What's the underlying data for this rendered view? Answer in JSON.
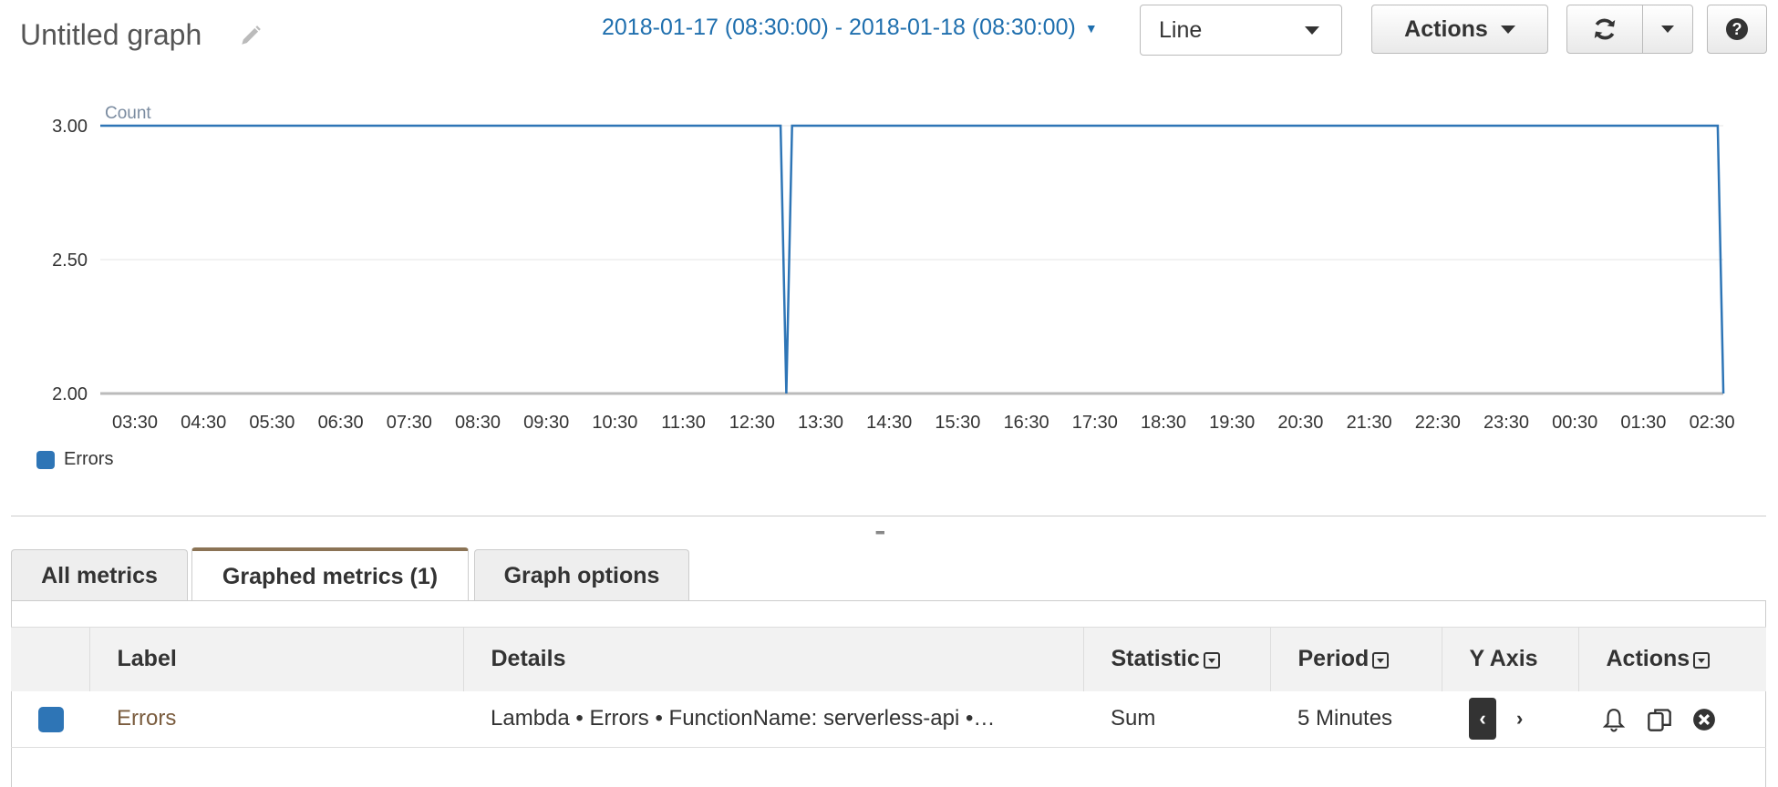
{
  "header": {
    "title": "Untitled graph",
    "date_range": "2018-01-17 (08:30:00) - 2018-01-18 (08:30:00)",
    "chart_type_select": "Line",
    "actions_label": "Actions",
    "help_label": "?"
  },
  "icons": {
    "edit": "pencil-icon",
    "date_caret": "caret-down-icon",
    "refresh": "refresh-icon",
    "refresh_dropdown": "caret-down-icon",
    "help": "question-circle-icon",
    "alarm": "bell-icon",
    "duplicate": "copy-icon",
    "remove": "close-circle-icon"
  },
  "colors": {
    "series": "#2e75b6",
    "link": "#1f6fae",
    "active_tab_accent": "#8b7355"
  },
  "chart_data": {
    "type": "line",
    "ylabel": "Count",
    "ylim": [
      2.0,
      3.0
    ],
    "y_ticks": [
      "3.00",
      "2.50",
      "2.00"
    ],
    "x_ticks": [
      "03:30",
      "04:30",
      "05:30",
      "06:30",
      "07:30",
      "08:30",
      "09:30",
      "10:30",
      "11:30",
      "12:30",
      "13:30",
      "14:30",
      "15:30",
      "16:30",
      "17:30",
      "18:30",
      "19:30",
      "20:30",
      "21:30",
      "22:30",
      "23:30",
      "00:30",
      "01:30",
      "02:30"
    ],
    "grid": true,
    "legend_placement": "bottom-left",
    "series": [
      {
        "name": "Errors",
        "points": [
          {
            "x": "03:10",
            "y": 3
          },
          {
            "x": "12:55",
            "y": 3
          },
          {
            "x": "13:00",
            "y": 2
          },
          {
            "x": "13:05",
            "y": 3
          },
          {
            "x": "02:35",
            "y": 3
          },
          {
            "x": "02:40",
            "y": 2
          }
        ]
      }
    ]
  },
  "tabs": [
    {
      "label": "All metrics"
    },
    {
      "label": "Graphed metrics (1)"
    },
    {
      "label": "Graph options"
    }
  ],
  "table": {
    "columns": [
      "Label",
      "Details",
      "Statistic",
      "Period",
      "Y Axis",
      "Actions"
    ],
    "rows": [
      {
        "label": "Errors",
        "details": "Lambda • Errors • FunctionName: serverless-api •…",
        "statistic": "Sum",
        "period": "5 Minutes",
        "y_axis_left": "‹",
        "y_axis_right": "›"
      }
    ]
  }
}
